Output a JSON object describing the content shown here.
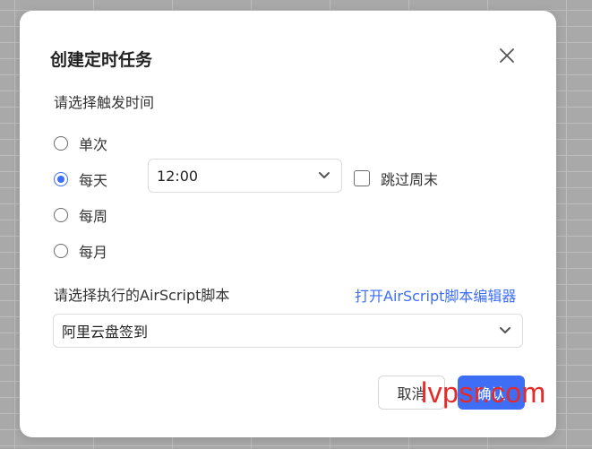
{
  "dialog": {
    "title": "创建定时任务",
    "close_icon": "close-icon",
    "trigger_label": "请选择触发时间",
    "options": [
      {
        "label": "单次",
        "selected": false
      },
      {
        "label": "每天",
        "selected": true
      },
      {
        "label": "每周",
        "selected": false
      },
      {
        "label": "每月",
        "selected": false
      }
    ],
    "time_value": "12:00",
    "skip_weekend_label": "跳过周末",
    "skip_weekend_checked": false,
    "script_label": "请选择执行的AirScript脚本",
    "open_editor_link": "打开AirScript脚本编辑器",
    "script_value": "阿里云盘签到",
    "cancel_label": "取消",
    "ok_label": "确认"
  },
  "watermark": "lvpsr.com",
  "colors": {
    "accent": "#3d6ef5",
    "watermark": "#e52a2a"
  }
}
